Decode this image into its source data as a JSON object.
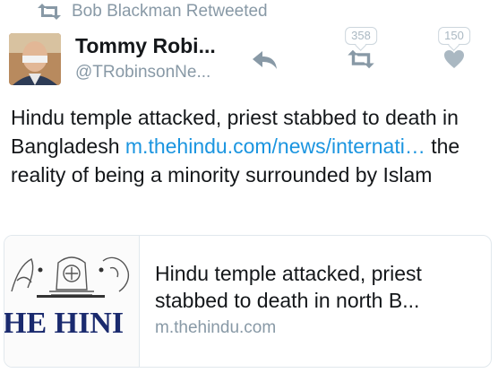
{
  "retweet_context": {
    "icon": "retweet-icon",
    "text": "Bob Blackman Retweeted"
  },
  "author": {
    "display_name": "Tommy Robi...",
    "handle": "@TRobinsonNe..."
  },
  "actions": {
    "reply_icon": "reply-arrow-icon",
    "retweet_count": "358",
    "like_count": "150"
  },
  "tweet": {
    "text_before_link": "Hindu temple attacked, priest stabbed to death in Bangladesh ",
    "link_text": "m.thehindu.com/news/​internati…",
    "text_after_link": " the reality of being a minority surrounded by Islam"
  },
  "card": {
    "thumbnail_text": "HE HINI",
    "title": "Hindu temple attacked, priest stabbed to death in north B...",
    "domain": "m.thehindu.com"
  },
  "colors": {
    "link": "#1b95e0",
    "muted": "#8899a6",
    "border": "#e1e8ed"
  }
}
